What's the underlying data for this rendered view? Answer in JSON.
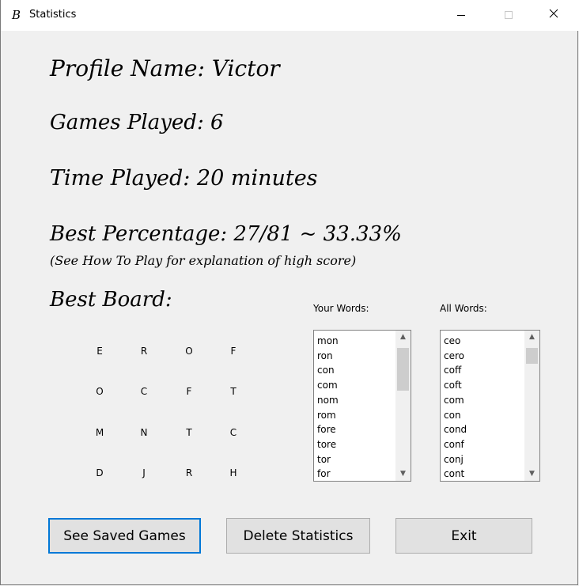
{
  "window": {
    "title": "Statistics",
    "app_icon_glyph": "B"
  },
  "stats": {
    "profile": "Profile Name: Victor",
    "games": "Games Played: 6",
    "time": "Time Played: 20 minutes",
    "best": "Best Percentage: 27/81 ~ 33.33%",
    "note": "(See How To Play for explanation of high score)",
    "board_title": "Best Board:"
  },
  "board": [
    [
      "E",
      "R",
      "O",
      "F"
    ],
    [
      "O",
      "C",
      "F",
      "T"
    ],
    [
      "M",
      "N",
      "T",
      "C"
    ],
    [
      "D",
      "J",
      "R",
      "H"
    ]
  ],
  "lists": {
    "your_label": "Your Words:",
    "all_label": "All Words:",
    "your_words": [
      "mon",
      "ron",
      "con",
      "com",
      "nom",
      "rom",
      "fore",
      "tore",
      "tor",
      "for"
    ],
    "all_words": [
      "ceo",
      "cero",
      "coff",
      "coft",
      "com",
      "con",
      "cond",
      "conf",
      "conj",
      "cont"
    ]
  },
  "buttons": {
    "saved": "See Saved Games",
    "delete": "Delete Statistics",
    "exit": "Exit"
  },
  "colors": {
    "focus": "#0078d7",
    "background": "#f0f0f0"
  }
}
